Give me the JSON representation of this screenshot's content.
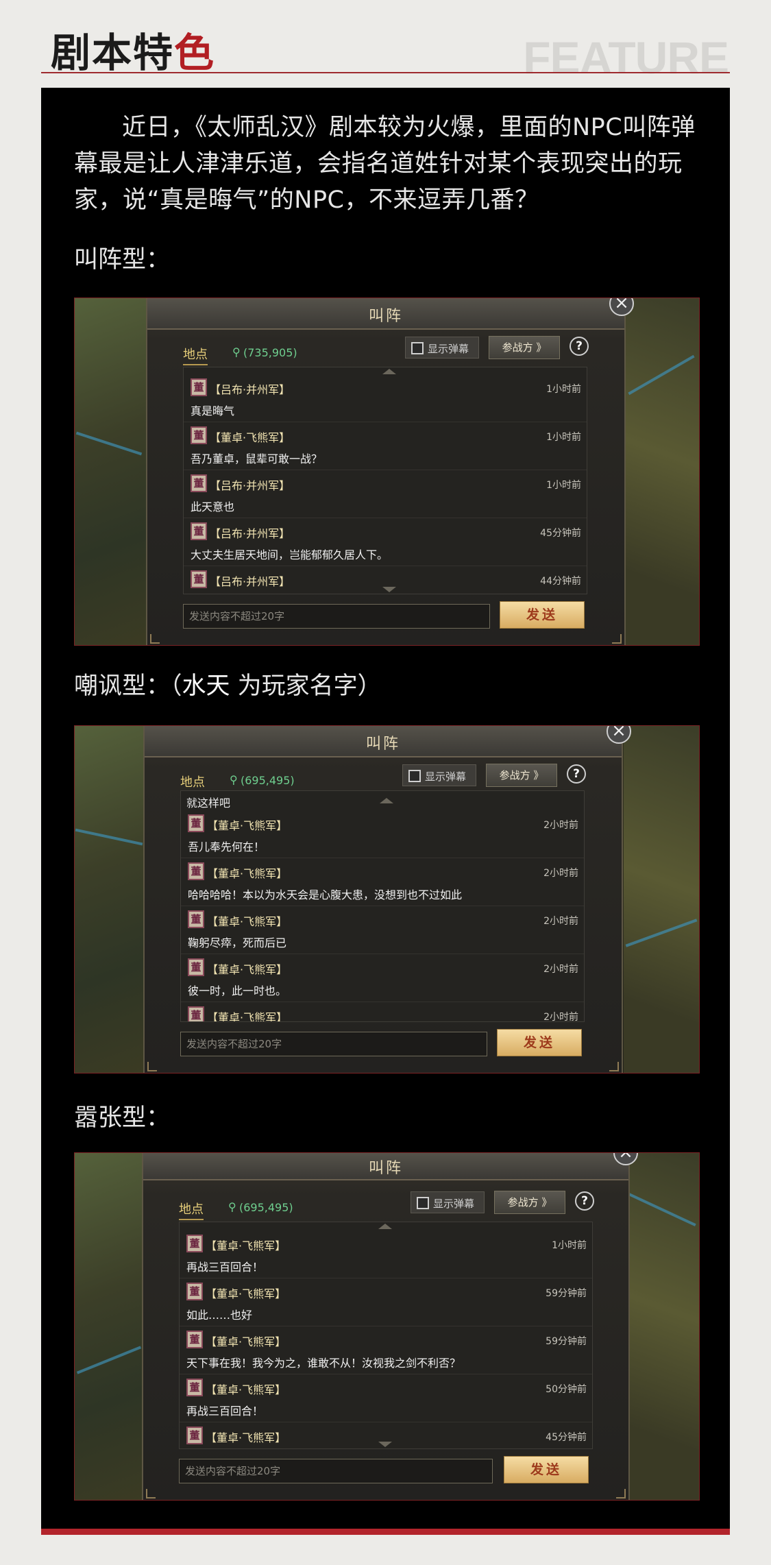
{
  "header": {
    "title_part1": "剧本特",
    "title_part2": "色",
    "feature": "FEATURE"
  },
  "intro": "近日，《太师乱汉》剧本较为火爆，里面的NPC叫阵弹幕最是让人津津乐道，会指名道姓针对某个表现突出的玩家，说“真是晦气”的NPC，不来逗弄几番？",
  "sections": [
    {
      "label": "叫阵型：",
      "dialog": {
        "title": "叫阵",
        "close": "×",
        "location_label": "地点",
        "coords": "(735,905)",
        "danmu_label": "显示弹幕",
        "side_btn": "参战方 》",
        "help": "?",
        "lead_line": "",
        "messages": [
          {
            "avatar": "董",
            "sender": "【吕布·并州军】",
            "time": "1小时前",
            "text": "真是晦气"
          },
          {
            "avatar": "董",
            "sender": "【董卓·飞熊军】",
            "time": "1小时前",
            "text": "吾乃董卓，鼠辈可敢一战？"
          },
          {
            "avatar": "董",
            "sender": "【吕布·并州军】",
            "time": "1小时前",
            "text": "此天意也"
          },
          {
            "avatar": "董",
            "sender": "【吕布·并州军】",
            "time": "45分钟前",
            "text": "大丈夫生居天地间，岂能郁郁久居人下。"
          },
          {
            "avatar": "董",
            "sender": "【吕布·并州军】",
            "time": "44分钟前",
            "text": ""
          }
        ],
        "input_placeholder": "发送内容不超过20字",
        "send": "发送"
      }
    },
    {
      "label_a": "嘲讽型：（",
      "label_hl": "水天",
      "label_b": " 为玩家名字）",
      "dialog": {
        "title": "叫阵",
        "close": "×",
        "location_label": "地点",
        "coords": "(695,495)",
        "danmu_label": "显示弹幕",
        "side_btn": "参战方 》",
        "help": "?",
        "lead_line": "就这样吧",
        "messages": [
          {
            "avatar": "董",
            "sender": "【董卓·飞熊军】",
            "time": "2小时前",
            "text": "吾儿奉先何在！"
          },
          {
            "avatar": "董",
            "sender": "【董卓·飞熊军】",
            "time": "2小时前",
            "text": "哈哈哈哈！本以为水天会是心腹大患，没想到也不过如此"
          },
          {
            "avatar": "董",
            "sender": "【董卓·飞熊军】",
            "time": "2小时前",
            "text": "鞠躬尽瘁，死而后已"
          },
          {
            "avatar": "董",
            "sender": "【董卓·飞熊军】",
            "time": "2小时前",
            "text": "彼一时，此一时也。"
          },
          {
            "avatar": "董",
            "sender": "【董卓·飞熊军】",
            "time": "2小时前",
            "text": ""
          }
        ],
        "input_placeholder": "发送内容不超过20字",
        "send": "发送"
      }
    },
    {
      "label": "嚣张型：",
      "dialog": {
        "title": "叫阵",
        "close": "×",
        "location_label": "地点",
        "coords": "(695,495)",
        "danmu_label": "显示弹幕",
        "side_btn": "参战方 》",
        "help": "?",
        "lead_line": "",
        "messages": [
          {
            "avatar": "董",
            "sender": "【董卓·飞熊军】",
            "time": "1小时前",
            "text": "再战三百回合！"
          },
          {
            "avatar": "董",
            "sender": "【董卓·飞熊军】",
            "time": "59分钟前",
            "text": "如此……也好"
          },
          {
            "avatar": "董",
            "sender": "【董卓·飞熊军】",
            "time": "59分钟前",
            "text": "天下事在我！我今为之，谁敢不从！汝视我之剑不利否？"
          },
          {
            "avatar": "董",
            "sender": "【董卓·飞熊军】",
            "time": "50分钟前",
            "text": "再战三百回合！"
          },
          {
            "avatar": "董",
            "sender": "【董卓·飞熊军】",
            "time": "45分钟前",
            "text": ""
          }
        ],
        "input_placeholder": "发送内容不超过20字",
        "send": "发送"
      }
    }
  ]
}
